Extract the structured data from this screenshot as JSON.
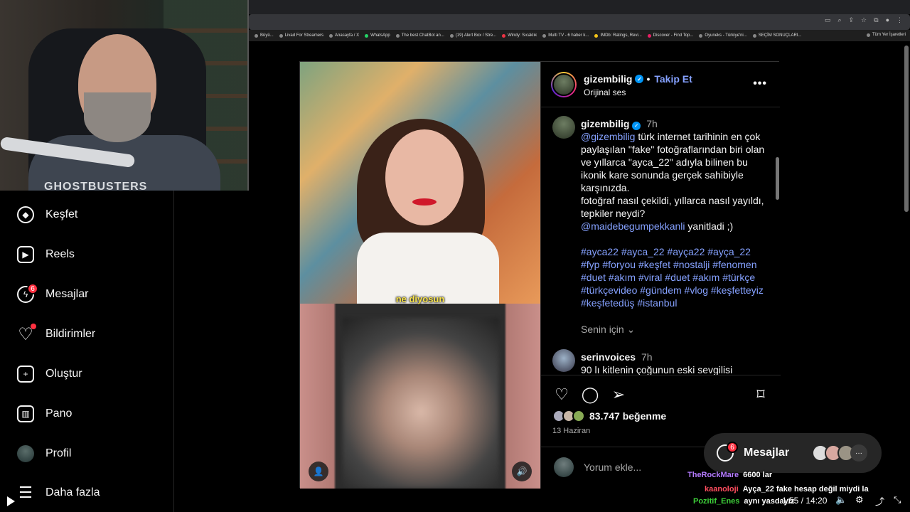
{
  "bookmarks": [
    "Büyü...",
    "Livad For Streamers",
    "Anasayfa / X",
    "WhatsApp",
    "The best ChatBot an...",
    "(19) Alert Box / Stre...",
    "Windy: Sıcaklık",
    "Multi TV - 6 haber k...",
    "IMDb: Ratings, Revi...",
    "Discover - Find Top...",
    "Oyuneks - Türkiye'ni...",
    "SEÇİM SONUÇLARI..."
  ],
  "bookmarks_right": "Tüm Yer İşaretleri",
  "webcam": {
    "shirt_text": "GHOSTBUSTERS"
  },
  "sidebar": {
    "items": [
      {
        "label": "Keşfet",
        "icon": "compass-icon"
      },
      {
        "label": "Reels",
        "icon": "reels-icon"
      },
      {
        "label": "Mesajlar",
        "icon": "messenger-icon",
        "badge": "6"
      },
      {
        "label": "Bildirimler",
        "icon": "heart-icon"
      },
      {
        "label": "Oluştur",
        "icon": "plus-square-icon"
      },
      {
        "label": "Pano",
        "icon": "dashboard-icon"
      },
      {
        "label": "Profil",
        "icon": "avatar"
      },
      {
        "label": "Daha fazla",
        "icon": "menu-icon"
      }
    ]
  },
  "video": {
    "caption": "ne diyosun"
  },
  "post": {
    "username": "gizembilig",
    "follow": "Takip Et",
    "subtitle": "Orijinal ses",
    "caption": {
      "username": "gizembilig",
      "time": "7h",
      "mention": "@gizembilig",
      "text": " türk internet tarihinin en çok paylaşılan \"fake\" fotoğraflarından biri olan ve yıllarca \"ayca_22\" adıyla bilinen bu ikonik kare sonunda gerçek sahibiyle karşınızda.",
      "text2": "fotoğraf nasıl çekildi, yıllarca nasıl yayıldı, tepkiler neydi?",
      "mention2": "@maidebegumpekkanli",
      "text3": " yanitladi ;)",
      "hashtags": "#ayca22 #ayca_22 #ayça22 #ayça_22 #fyp #foryou #keşfet #nostalji #fenomen #duet #akım #viral #duet #akım #türkçe #türkçevideo #gündem #vlog #keşfetteyiz #keşfetedüş #istanbul"
    },
    "for_you": "Senin için",
    "comment": {
      "username": "serinvoices",
      "time": "7h",
      "text": "90 lı kitlenin çoğunun eski sevgilisi"
    },
    "likes": "83.747 beğenme",
    "date": "13 Haziran",
    "add_comment_placeholder": "Yorum ekle..."
  },
  "messages_pill": {
    "label": "Mesajlar",
    "badge": "6"
  },
  "chat": [
    {
      "user": "TheRockMare",
      "text": "6600 lar",
      "color": "#b57bff"
    },
    {
      "user": "kaanoloji",
      "text": "Ayça_22 fake hesap değil miydi la",
      "color": "#ff4d5e"
    },
    {
      "user": "Pozitif_Enes",
      "text": "aynı yasdayiz",
      "color": "#3ed13a"
    }
  ],
  "player": {
    "time": "1:55 / 14:20"
  }
}
